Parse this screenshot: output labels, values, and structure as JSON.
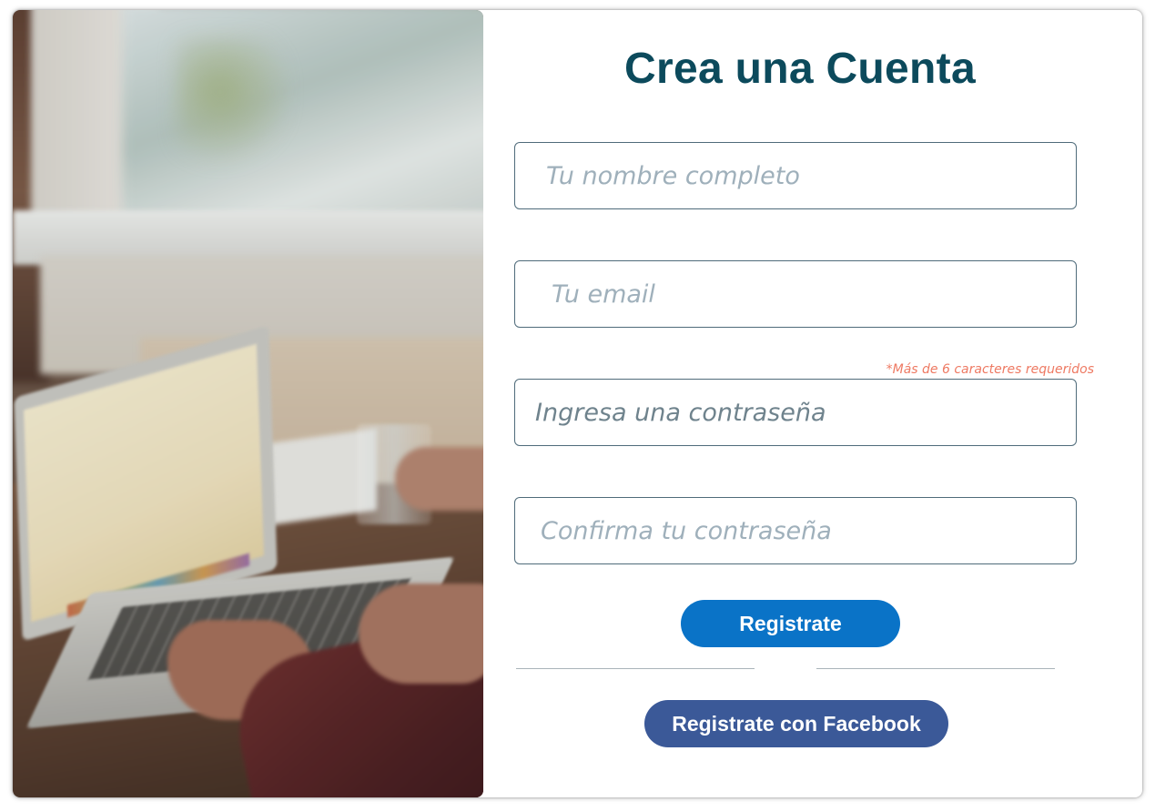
{
  "form": {
    "title": "Crea una Cuenta",
    "name_placeholder": "Tu nombre completo",
    "email_placeholder": "Tu email",
    "password_hint": "*Más de 6 caracteres requeridos",
    "password_placeholder": "Ingresa una contraseña",
    "confirm_placeholder": "Confirma tu contraseña",
    "register_label": "Registrate",
    "facebook_label": "Registrate con Facebook"
  },
  "photo": {
    "subject": "person-typing-on-laptop-photo"
  },
  "colors": {
    "title": "#0c4a5c",
    "register_button": "#0a73c7",
    "facebook_button": "#3b5998",
    "hint": "#ee7a63",
    "field_border": "#4f6b7a"
  }
}
